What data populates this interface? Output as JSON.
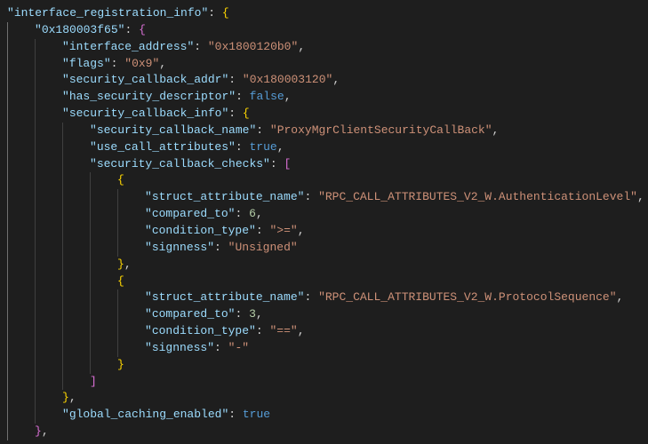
{
  "root_key": "interface_registration_info",
  "nested_key": "0x180003f65",
  "fields": {
    "interface_address": {
      "key": "interface_address",
      "value": "0x1800120b0"
    },
    "flags": {
      "key": "flags",
      "value": "0x9"
    },
    "security_callback_addr": {
      "key": "security_callback_addr",
      "value": "0x180003120"
    },
    "has_security_descriptor": {
      "key": "has_security_descriptor",
      "value": "false"
    },
    "security_callback_info": {
      "key": "security_callback_info"
    },
    "security_callback_name": {
      "key": "security_callback_name",
      "value": "ProxyMgrClientSecurityCallBack"
    },
    "use_call_attributes": {
      "key": "use_call_attributes",
      "value": "true"
    },
    "security_callback_checks": {
      "key": "security_callback_checks"
    },
    "struct_attribute_name": {
      "key": "struct_attribute_name"
    },
    "compared_to": {
      "key": "compared_to"
    },
    "condition_type": {
      "key": "condition_type"
    },
    "signness": {
      "key": "signness"
    },
    "global_caching_enabled": {
      "key": "global_caching_enabled",
      "value": "true"
    }
  },
  "checks": [
    {
      "struct_attribute_name": "RPC_CALL_ATTRIBUTES_V2_W.AuthenticationLevel",
      "compared_to": "6",
      "condition_type": ">=",
      "signness": "Unsigned"
    },
    {
      "struct_attribute_name": "RPC_CALL_ATTRIBUTES_V2_W.ProtocolSequence",
      "compared_to": "3",
      "condition_type": "==",
      "signness": "-"
    }
  ],
  "chart_data": {
    "type": "table",
    "title": "interface_registration_info JSON source",
    "rows": [
      [
        "interface_registration_info.0x180003f65.interface_address",
        "0x1800120b0"
      ],
      [
        "interface_registration_info.0x180003f65.flags",
        "0x9"
      ],
      [
        "interface_registration_info.0x180003f65.security_callback_addr",
        "0x180003120"
      ],
      [
        "interface_registration_info.0x180003f65.has_security_descriptor",
        false
      ],
      [
        "interface_registration_info.0x180003f65.security_callback_info.security_callback_name",
        "ProxyMgrClientSecurityCallBack"
      ],
      [
        "interface_registration_info.0x180003f65.security_callback_info.use_call_attributes",
        true
      ],
      [
        "interface_registration_info.0x180003f65.security_callback_info.security_callback_checks[0].struct_attribute_name",
        "RPC_CALL_ATTRIBUTES_V2_W.AuthenticationLevel"
      ],
      [
        "interface_registration_info.0x180003f65.security_callback_info.security_callback_checks[0].compared_to",
        6
      ],
      [
        "interface_registration_info.0x180003f65.security_callback_info.security_callback_checks[0].condition_type",
        ">="
      ],
      [
        "interface_registration_info.0x180003f65.security_callback_info.security_callback_checks[0].signness",
        "Unsigned"
      ],
      [
        "interface_registration_info.0x180003f65.security_callback_info.security_callback_checks[1].struct_attribute_name",
        "RPC_CALL_ATTRIBUTES_V2_W.ProtocolSequence"
      ],
      [
        "interface_registration_info.0x180003f65.security_callback_info.security_callback_checks[1].compared_to",
        3
      ],
      [
        "interface_registration_info.0x180003f65.security_callback_info.security_callback_checks[1].condition_type",
        "=="
      ],
      [
        "interface_registration_info.0x180003f65.security_callback_info.security_callback_checks[1].signness",
        "-"
      ],
      [
        "interface_registration_info.0x180003f65.global_caching_enabled",
        true
      ]
    ]
  }
}
